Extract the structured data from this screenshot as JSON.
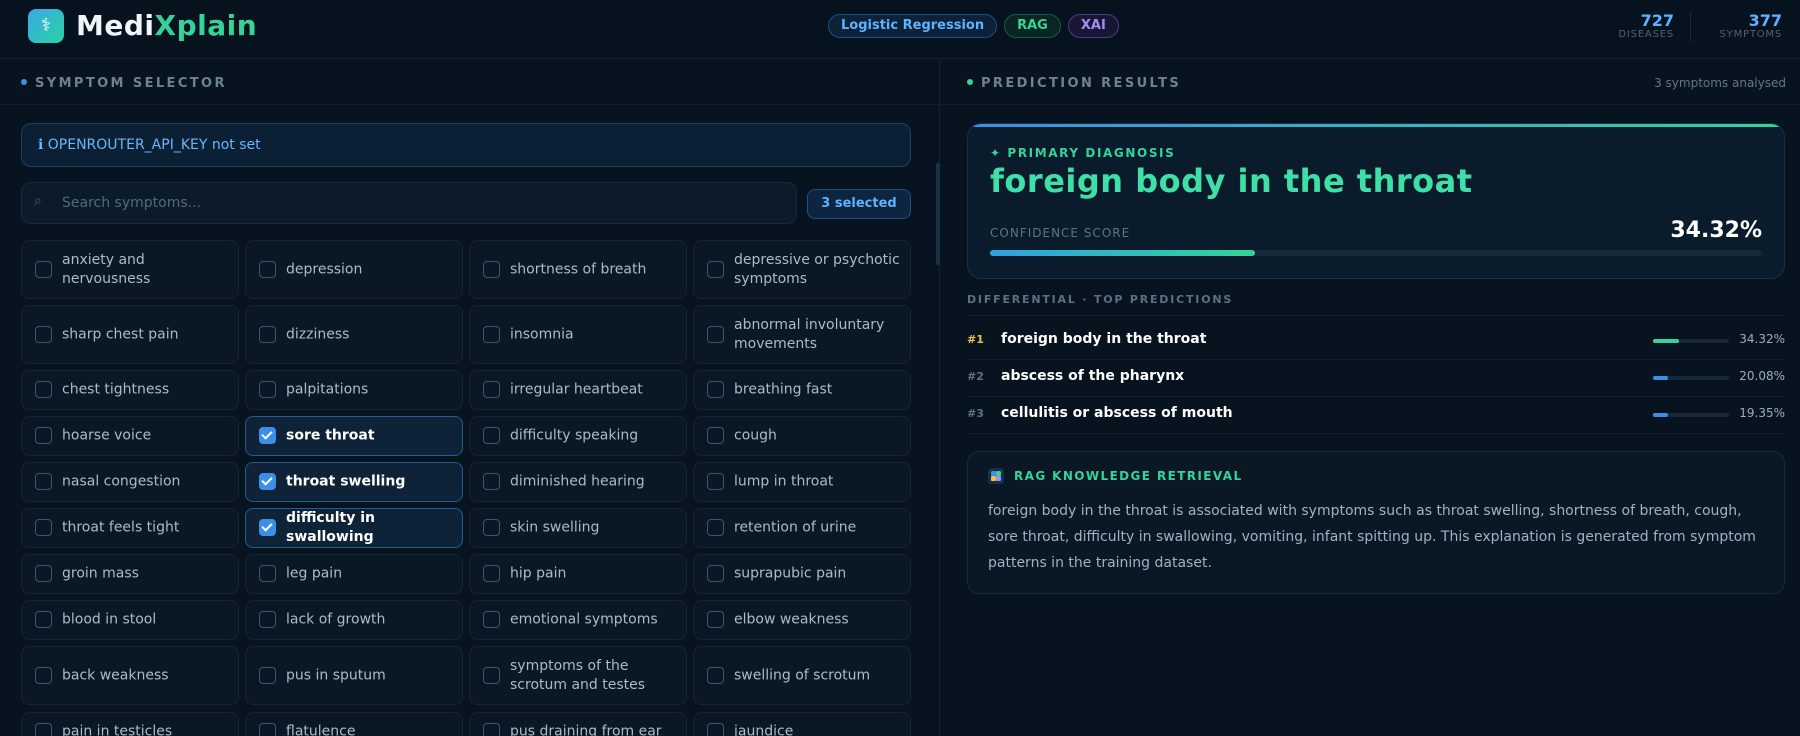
{
  "header": {
    "logo_part1": "Medi",
    "logo_part2": "Xplain",
    "logo_icon": "shield-icon",
    "tags": [
      "Logistic Regression",
      "RAG",
      "XAI"
    ],
    "stats": [
      {
        "value": "727",
        "label": "DISEASES"
      },
      {
        "value": "377",
        "label": "SYMPTOMS"
      }
    ]
  },
  "left": {
    "title": "SYMPTOM SELECTOR",
    "api_warning": "OPENROUTER_API_KEY not set",
    "search_placeholder": "Search symptoms...",
    "selected_label": "3 selected",
    "symptoms": [
      {
        "label": "anxiety and nervousness",
        "checked": false
      },
      {
        "label": "depression",
        "checked": false
      },
      {
        "label": "shortness of breath",
        "checked": false
      },
      {
        "label": "depressive or psychotic symptoms",
        "checked": false
      },
      {
        "label": "sharp chest pain",
        "checked": false
      },
      {
        "label": "dizziness",
        "checked": false
      },
      {
        "label": "insomnia",
        "checked": false
      },
      {
        "label": "abnormal involuntary movements",
        "checked": false
      },
      {
        "label": "chest tightness",
        "checked": false
      },
      {
        "label": "palpitations",
        "checked": false
      },
      {
        "label": "irregular heartbeat",
        "checked": false
      },
      {
        "label": "breathing fast",
        "checked": false
      },
      {
        "label": "hoarse voice",
        "checked": false
      },
      {
        "label": "sore throat",
        "checked": true
      },
      {
        "label": "difficulty speaking",
        "checked": false
      },
      {
        "label": "cough",
        "checked": false
      },
      {
        "label": "nasal congestion",
        "checked": false
      },
      {
        "label": "throat swelling",
        "checked": true
      },
      {
        "label": "diminished hearing",
        "checked": false
      },
      {
        "label": "lump in throat",
        "checked": false
      },
      {
        "label": "throat feels tight",
        "checked": false
      },
      {
        "label": "difficulty in swallowing",
        "checked": true
      },
      {
        "label": "skin swelling",
        "checked": false
      },
      {
        "label": "retention of urine",
        "checked": false
      },
      {
        "label": "groin mass",
        "checked": false
      },
      {
        "label": "leg pain",
        "checked": false
      },
      {
        "label": "hip pain",
        "checked": false
      },
      {
        "label": "suprapubic pain",
        "checked": false
      },
      {
        "label": "blood in stool",
        "checked": false
      },
      {
        "label": "lack of growth",
        "checked": false
      },
      {
        "label": "emotional symptoms",
        "checked": false
      },
      {
        "label": "elbow weakness",
        "checked": false
      },
      {
        "label": "back weakness",
        "checked": false
      },
      {
        "label": "pus in sputum",
        "checked": false
      },
      {
        "label": "symptoms of the scrotum and testes",
        "checked": false
      },
      {
        "label": "swelling of scrotum",
        "checked": false
      },
      {
        "label": "pain in testicles",
        "checked": false
      },
      {
        "label": "flatulence",
        "checked": false
      },
      {
        "label": "pus draining from ear",
        "checked": false
      },
      {
        "label": "jaundice",
        "checked": false
      }
    ]
  },
  "right": {
    "title": "PREDICTION RESULTS",
    "analysed": "3 symptoms analysed",
    "primary_label": "✦ PRIMARY DIAGNOSIS",
    "primary_name": "foreign body in the throat",
    "confidence_label": "CONFIDENCE SCORE",
    "confidence_value": "34.32%",
    "confidence_fraction": 0.3432,
    "differential_title": "DIFFERENTIAL · TOP PREDICTIONS",
    "predictions": [
      {
        "rank": "#1",
        "name": "foreign body in the throat",
        "pct": "34.32%",
        "fraction": 0.3432,
        "color": "#34d399"
      },
      {
        "rank": "#2",
        "name": "abscess of the pharynx",
        "pct": "20.08%",
        "fraction": 0.2008,
        "color": "#3b8fe6"
      },
      {
        "rank": "#3",
        "name": "cellulitis or abscess of mouth",
        "pct": "19.35%",
        "fraction": 0.1935,
        "color": "#3b8fe6"
      }
    ],
    "rag_title": "RAG KNOWLEDGE RETRIEVAL",
    "rag_text": "foreign body in the throat is associated with symptoms such as throat swelling, shortness of breath, cough, sore throat, difficulty in swallowing, vomiting, infant spitting up. This explanation is generated from symptom patterns in the training dataset."
  },
  "colors": {
    "accent_blue": "#3b8fe6",
    "accent_green": "#34d399",
    "rank_gold": "#f0c04a",
    "background": "#071420"
  }
}
